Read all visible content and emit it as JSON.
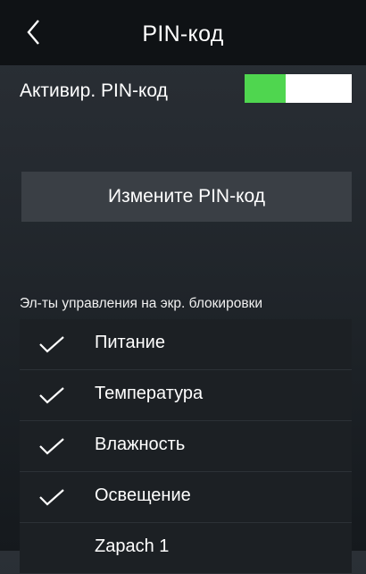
{
  "header": {
    "title": "PIN-код",
    "back_icon": "chevron-left-icon"
  },
  "pin": {
    "label": "Активир. PIN-код",
    "enabled": true,
    "on_color": "#4fd64f"
  },
  "change_button": {
    "label": "Измените PIN-код"
  },
  "lock_controls": {
    "section_label": "Эл-ты управления на экр. блокировки",
    "items": [
      {
        "label": "Питание",
        "checked": true
      },
      {
        "label": "Температура",
        "checked": true
      },
      {
        "label": "Влажность",
        "checked": true
      },
      {
        "label": "Освещение",
        "checked": true
      },
      {
        "label": "Zapach 1",
        "checked": false
      }
    ]
  }
}
